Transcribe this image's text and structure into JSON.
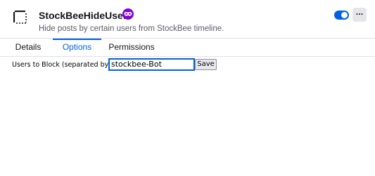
{
  "header": {
    "extension_name": "StockBeeHideUsers",
    "description": "Hide posts by certain users from StockBee timeline.",
    "enabled": true,
    "more_options_icon": "···",
    "icons": {
      "extension_icon": "puzzle-placeholder-icon",
      "private_badge": "private-browsing-mask-icon",
      "toggle": "toggle-switch",
      "more": "ellipsis-icon"
    }
  },
  "tabs": [
    {
      "label": "Details",
      "selected": false
    },
    {
      "label": "Options",
      "selected": true
    },
    {
      "label": "Permissions",
      "selected": false
    }
  ],
  "options": {
    "field_label": "Users to Block (separated by \",\"):",
    "field_value": "stockbee-Bot",
    "save_label": "Save"
  },
  "colors": {
    "accent": "#0061e0",
    "private_badge": "#8000d7",
    "description_text": "#5b5b66"
  }
}
